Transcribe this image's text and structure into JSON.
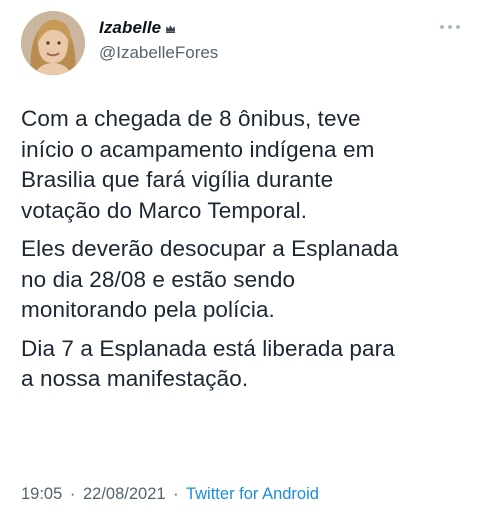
{
  "author": {
    "display_name": "Izabelle",
    "handle": "@IzabelleFores",
    "avatar_icon": "profile-photo",
    "badge_icon": "crown-icon"
  },
  "tweet": {
    "paragraphs": [
      {
        "lines": [
          "Com a chegada de 8 ônibus, teve",
          "início o acampamento indígena em",
          "Brasilia que fará vigília durante",
          "votação do Marco Temporal."
        ]
      },
      {
        "lines": [
          "Eles deverão desocupar a Esplanada",
          "no dia 28/08 e estão sendo",
          "monitorando pela polícia."
        ]
      },
      {
        "lines": [
          "Dia 7 a Esplanada está liberada para",
          "a nossa manifestação."
        ]
      }
    ]
  },
  "meta": {
    "time": "19:05",
    "separator": "·",
    "date": "22/08/2021",
    "source": "Twitter for Android"
  },
  "colors": {
    "text_primary": "#0f1419",
    "text_secondary": "#536471",
    "link": "#1d8ed6"
  }
}
